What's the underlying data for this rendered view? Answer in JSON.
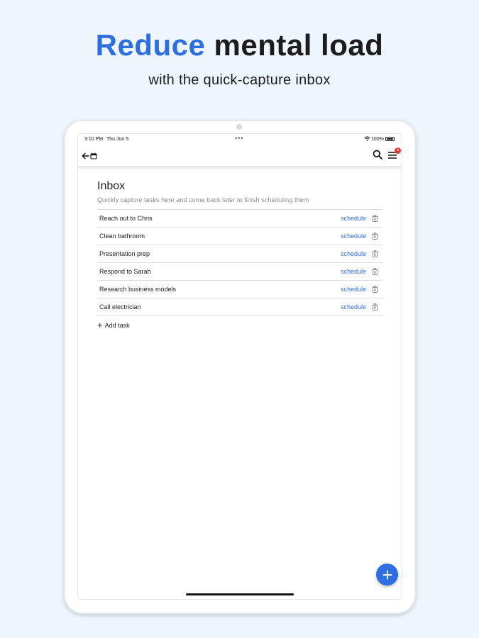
{
  "hero": {
    "headline_accent": "Reduce",
    "headline_rest": " mental load",
    "subhead": "with the quick-capture inbox",
    "accent_color": "#2d6fe0"
  },
  "statusbar": {
    "time": "3:10 PM",
    "date": "Thu Jun 5",
    "battery": "100%"
  },
  "toolbar": {
    "back_icon": "arrow-left-icon",
    "calendar_icon": "calendar-icon",
    "search_icon": "search-icon",
    "menu_icon": "menu-icon",
    "menu_badge": "5"
  },
  "inbox": {
    "title": "Inbox",
    "description": "Quickly capture tasks here and come back later to finish scheduling them",
    "schedule_label": "schedule",
    "tasks": [
      {
        "name": "Reach out to Chris"
      },
      {
        "name": "Clean bathroom"
      },
      {
        "name": "Presentation prep"
      },
      {
        "name": "Respond to Sarah"
      },
      {
        "name": "Research business models"
      },
      {
        "name": "Call electrician"
      }
    ],
    "add_task_label": "Add task"
  },
  "fab": {
    "icon": "plus-icon",
    "color": "#2d6fe0"
  }
}
